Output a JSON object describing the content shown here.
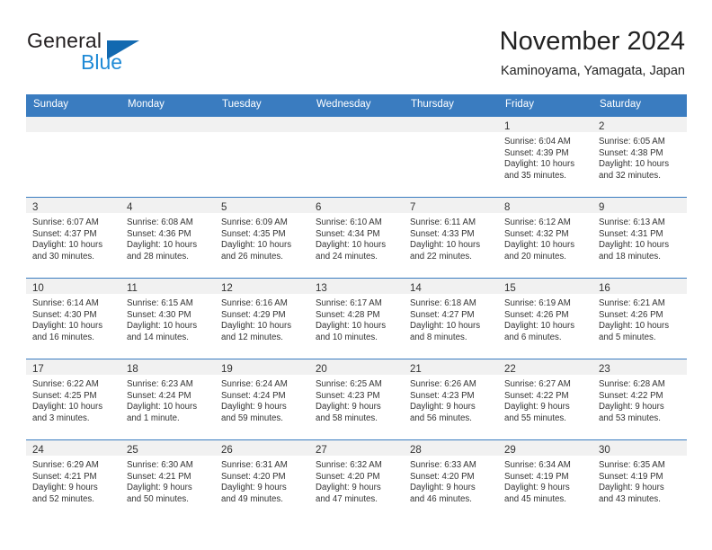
{
  "brand": {
    "name_part1": "General",
    "name_part2": "Blue",
    "logo_icon": "blue-triangle-icon"
  },
  "header": {
    "title": "November 2024",
    "subtitle": "Kaminoyama, Yamagata, Japan"
  },
  "colors": {
    "header_blue": "#3a7cc0",
    "logo_dark_blue": "#1269b0",
    "logo_light_blue": "#1f8ad6",
    "daynum_band": "#f1f1f1",
    "text": "#333333"
  },
  "weekdays": [
    "Sunday",
    "Monday",
    "Tuesday",
    "Wednesday",
    "Thursday",
    "Friday",
    "Saturday"
  ],
  "labels": {
    "sunrise_prefix": "Sunrise:",
    "sunset_prefix": "Sunset:",
    "daylight_prefix": "Daylight:"
  },
  "weeks": [
    [
      {
        "day": "",
        "blank": true,
        "line1": "",
        "line2": "",
        "line3": "",
        "line4": ""
      },
      {
        "day": "",
        "blank": true,
        "line1": "",
        "line2": "",
        "line3": "",
        "line4": ""
      },
      {
        "day": "",
        "blank": true,
        "line1": "",
        "line2": "",
        "line3": "",
        "line4": ""
      },
      {
        "day": "",
        "blank": true,
        "line1": "",
        "line2": "",
        "line3": "",
        "line4": ""
      },
      {
        "day": "",
        "blank": true,
        "line1": "",
        "line2": "",
        "line3": "",
        "line4": ""
      },
      {
        "day": "1",
        "blank": false,
        "line1": "Sunrise: 6:04 AM",
        "line2": "Sunset: 4:39 PM",
        "line3": "Daylight: 10 hours",
        "line4": "and 35 minutes."
      },
      {
        "day": "2",
        "blank": false,
        "line1": "Sunrise: 6:05 AM",
        "line2": "Sunset: 4:38 PM",
        "line3": "Daylight: 10 hours",
        "line4": "and 32 minutes."
      }
    ],
    [
      {
        "day": "3",
        "blank": false,
        "line1": "Sunrise: 6:07 AM",
        "line2": "Sunset: 4:37 PM",
        "line3": "Daylight: 10 hours",
        "line4": "and 30 minutes."
      },
      {
        "day": "4",
        "blank": false,
        "line1": "Sunrise: 6:08 AM",
        "line2": "Sunset: 4:36 PM",
        "line3": "Daylight: 10 hours",
        "line4": "and 28 minutes."
      },
      {
        "day": "5",
        "blank": false,
        "line1": "Sunrise: 6:09 AM",
        "line2": "Sunset: 4:35 PM",
        "line3": "Daylight: 10 hours",
        "line4": "and 26 minutes."
      },
      {
        "day": "6",
        "blank": false,
        "line1": "Sunrise: 6:10 AM",
        "line2": "Sunset: 4:34 PM",
        "line3": "Daylight: 10 hours",
        "line4": "and 24 minutes."
      },
      {
        "day": "7",
        "blank": false,
        "line1": "Sunrise: 6:11 AM",
        "line2": "Sunset: 4:33 PM",
        "line3": "Daylight: 10 hours",
        "line4": "and 22 minutes."
      },
      {
        "day": "8",
        "blank": false,
        "line1": "Sunrise: 6:12 AM",
        "line2": "Sunset: 4:32 PM",
        "line3": "Daylight: 10 hours",
        "line4": "and 20 minutes."
      },
      {
        "day": "9",
        "blank": false,
        "line1": "Sunrise: 6:13 AM",
        "line2": "Sunset: 4:31 PM",
        "line3": "Daylight: 10 hours",
        "line4": "and 18 minutes."
      }
    ],
    [
      {
        "day": "10",
        "blank": false,
        "line1": "Sunrise: 6:14 AM",
        "line2": "Sunset: 4:30 PM",
        "line3": "Daylight: 10 hours",
        "line4": "and 16 minutes."
      },
      {
        "day": "11",
        "blank": false,
        "line1": "Sunrise: 6:15 AM",
        "line2": "Sunset: 4:30 PM",
        "line3": "Daylight: 10 hours",
        "line4": "and 14 minutes."
      },
      {
        "day": "12",
        "blank": false,
        "line1": "Sunrise: 6:16 AM",
        "line2": "Sunset: 4:29 PM",
        "line3": "Daylight: 10 hours",
        "line4": "and 12 minutes."
      },
      {
        "day": "13",
        "blank": false,
        "line1": "Sunrise: 6:17 AM",
        "line2": "Sunset: 4:28 PM",
        "line3": "Daylight: 10 hours",
        "line4": "and 10 minutes."
      },
      {
        "day": "14",
        "blank": false,
        "line1": "Sunrise: 6:18 AM",
        "line2": "Sunset: 4:27 PM",
        "line3": "Daylight: 10 hours",
        "line4": "and 8 minutes."
      },
      {
        "day": "15",
        "blank": false,
        "line1": "Sunrise: 6:19 AM",
        "line2": "Sunset: 4:26 PM",
        "line3": "Daylight: 10 hours",
        "line4": "and 6 minutes."
      },
      {
        "day": "16",
        "blank": false,
        "line1": "Sunrise: 6:21 AM",
        "line2": "Sunset: 4:26 PM",
        "line3": "Daylight: 10 hours",
        "line4": "and 5 minutes."
      }
    ],
    [
      {
        "day": "17",
        "blank": false,
        "line1": "Sunrise: 6:22 AM",
        "line2": "Sunset: 4:25 PM",
        "line3": "Daylight: 10 hours",
        "line4": "and 3 minutes."
      },
      {
        "day": "18",
        "blank": false,
        "line1": "Sunrise: 6:23 AM",
        "line2": "Sunset: 4:24 PM",
        "line3": "Daylight: 10 hours",
        "line4": "and 1 minute."
      },
      {
        "day": "19",
        "blank": false,
        "line1": "Sunrise: 6:24 AM",
        "line2": "Sunset: 4:24 PM",
        "line3": "Daylight: 9 hours",
        "line4": "and 59 minutes."
      },
      {
        "day": "20",
        "blank": false,
        "line1": "Sunrise: 6:25 AM",
        "line2": "Sunset: 4:23 PM",
        "line3": "Daylight: 9 hours",
        "line4": "and 58 minutes."
      },
      {
        "day": "21",
        "blank": false,
        "line1": "Sunrise: 6:26 AM",
        "line2": "Sunset: 4:23 PM",
        "line3": "Daylight: 9 hours",
        "line4": "and 56 minutes."
      },
      {
        "day": "22",
        "blank": false,
        "line1": "Sunrise: 6:27 AM",
        "line2": "Sunset: 4:22 PM",
        "line3": "Daylight: 9 hours",
        "line4": "and 55 minutes."
      },
      {
        "day": "23",
        "blank": false,
        "line1": "Sunrise: 6:28 AM",
        "line2": "Sunset: 4:22 PM",
        "line3": "Daylight: 9 hours",
        "line4": "and 53 minutes."
      }
    ],
    [
      {
        "day": "24",
        "blank": false,
        "line1": "Sunrise: 6:29 AM",
        "line2": "Sunset: 4:21 PM",
        "line3": "Daylight: 9 hours",
        "line4": "and 52 minutes."
      },
      {
        "day": "25",
        "blank": false,
        "line1": "Sunrise: 6:30 AM",
        "line2": "Sunset: 4:21 PM",
        "line3": "Daylight: 9 hours",
        "line4": "and 50 minutes."
      },
      {
        "day": "26",
        "blank": false,
        "line1": "Sunrise: 6:31 AM",
        "line2": "Sunset: 4:20 PM",
        "line3": "Daylight: 9 hours",
        "line4": "and 49 minutes."
      },
      {
        "day": "27",
        "blank": false,
        "line1": "Sunrise: 6:32 AM",
        "line2": "Sunset: 4:20 PM",
        "line3": "Daylight: 9 hours",
        "line4": "and 47 minutes."
      },
      {
        "day": "28",
        "blank": false,
        "line1": "Sunrise: 6:33 AM",
        "line2": "Sunset: 4:20 PM",
        "line3": "Daylight: 9 hours",
        "line4": "and 46 minutes."
      },
      {
        "day": "29",
        "blank": false,
        "line1": "Sunrise: 6:34 AM",
        "line2": "Sunset: 4:19 PM",
        "line3": "Daylight: 9 hours",
        "line4": "and 45 minutes."
      },
      {
        "day": "30",
        "blank": false,
        "line1": "Sunrise: 6:35 AM",
        "line2": "Sunset: 4:19 PM",
        "line3": "Daylight: 9 hours",
        "line4": "and 43 minutes."
      }
    ]
  ]
}
